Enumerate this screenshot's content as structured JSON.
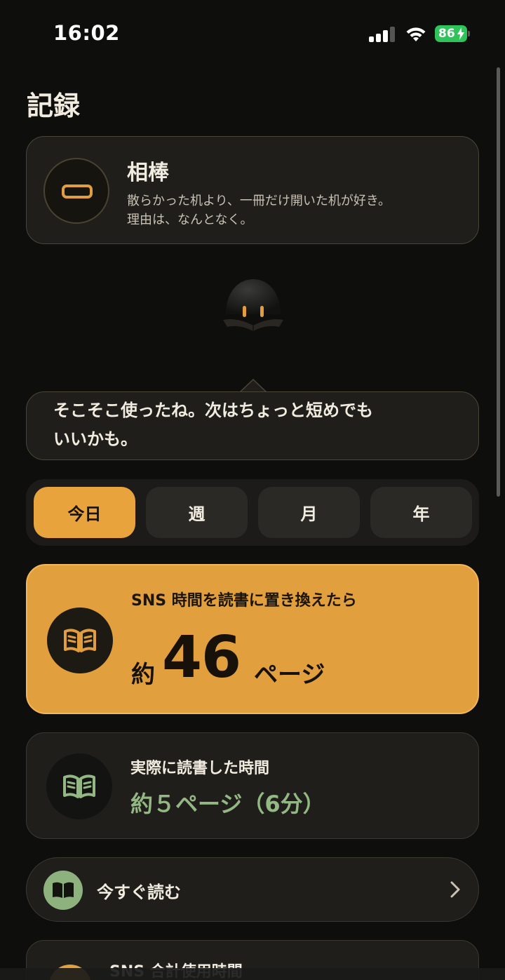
{
  "status_bar": {
    "time": "16:02",
    "battery_level": "86",
    "icons": [
      "cellular-signal-icon",
      "wifi-icon",
      "battery-charging-icon"
    ]
  },
  "page": {
    "title": "記録"
  },
  "partner": {
    "title": "相棒",
    "description_line1": "散らかった机より、一冊だけ開いた机が好き。",
    "description_line2": "理由は、なんとなく。",
    "icon": "partner-avatar-icon"
  },
  "mascot": {
    "icon": "mascot-reading-icon"
  },
  "speech": {
    "line1": "そこそこ使ったね。次はちょっと短めでも",
    "line2": "いいかも。"
  },
  "period_tabs": [
    {
      "label": "今日",
      "active": true
    },
    {
      "label": "週",
      "active": false
    },
    {
      "label": "月",
      "active": false
    },
    {
      "label": "年",
      "active": false
    }
  ],
  "sns_replacement": {
    "label": "SNS 時間を読書に置き換えたら",
    "prefix": "約",
    "value": "46",
    "unit": "ページ",
    "icon": "open-book-icon"
  },
  "actual_reading": {
    "label": "実際に読書した時間",
    "value": "約５ページ（6分）",
    "icon": "open-book-icon"
  },
  "read_now": {
    "label": "今すぐ読む",
    "icon": "book-icon",
    "chevron": "chevron-right-icon"
  },
  "sns_total": {
    "label": "SNS 合計使用時間"
  },
  "colors": {
    "background": "#0e0e0d",
    "accent_orange": "#e19f3d",
    "accent_green": "#93b883",
    "card": "#1f1e1b"
  }
}
